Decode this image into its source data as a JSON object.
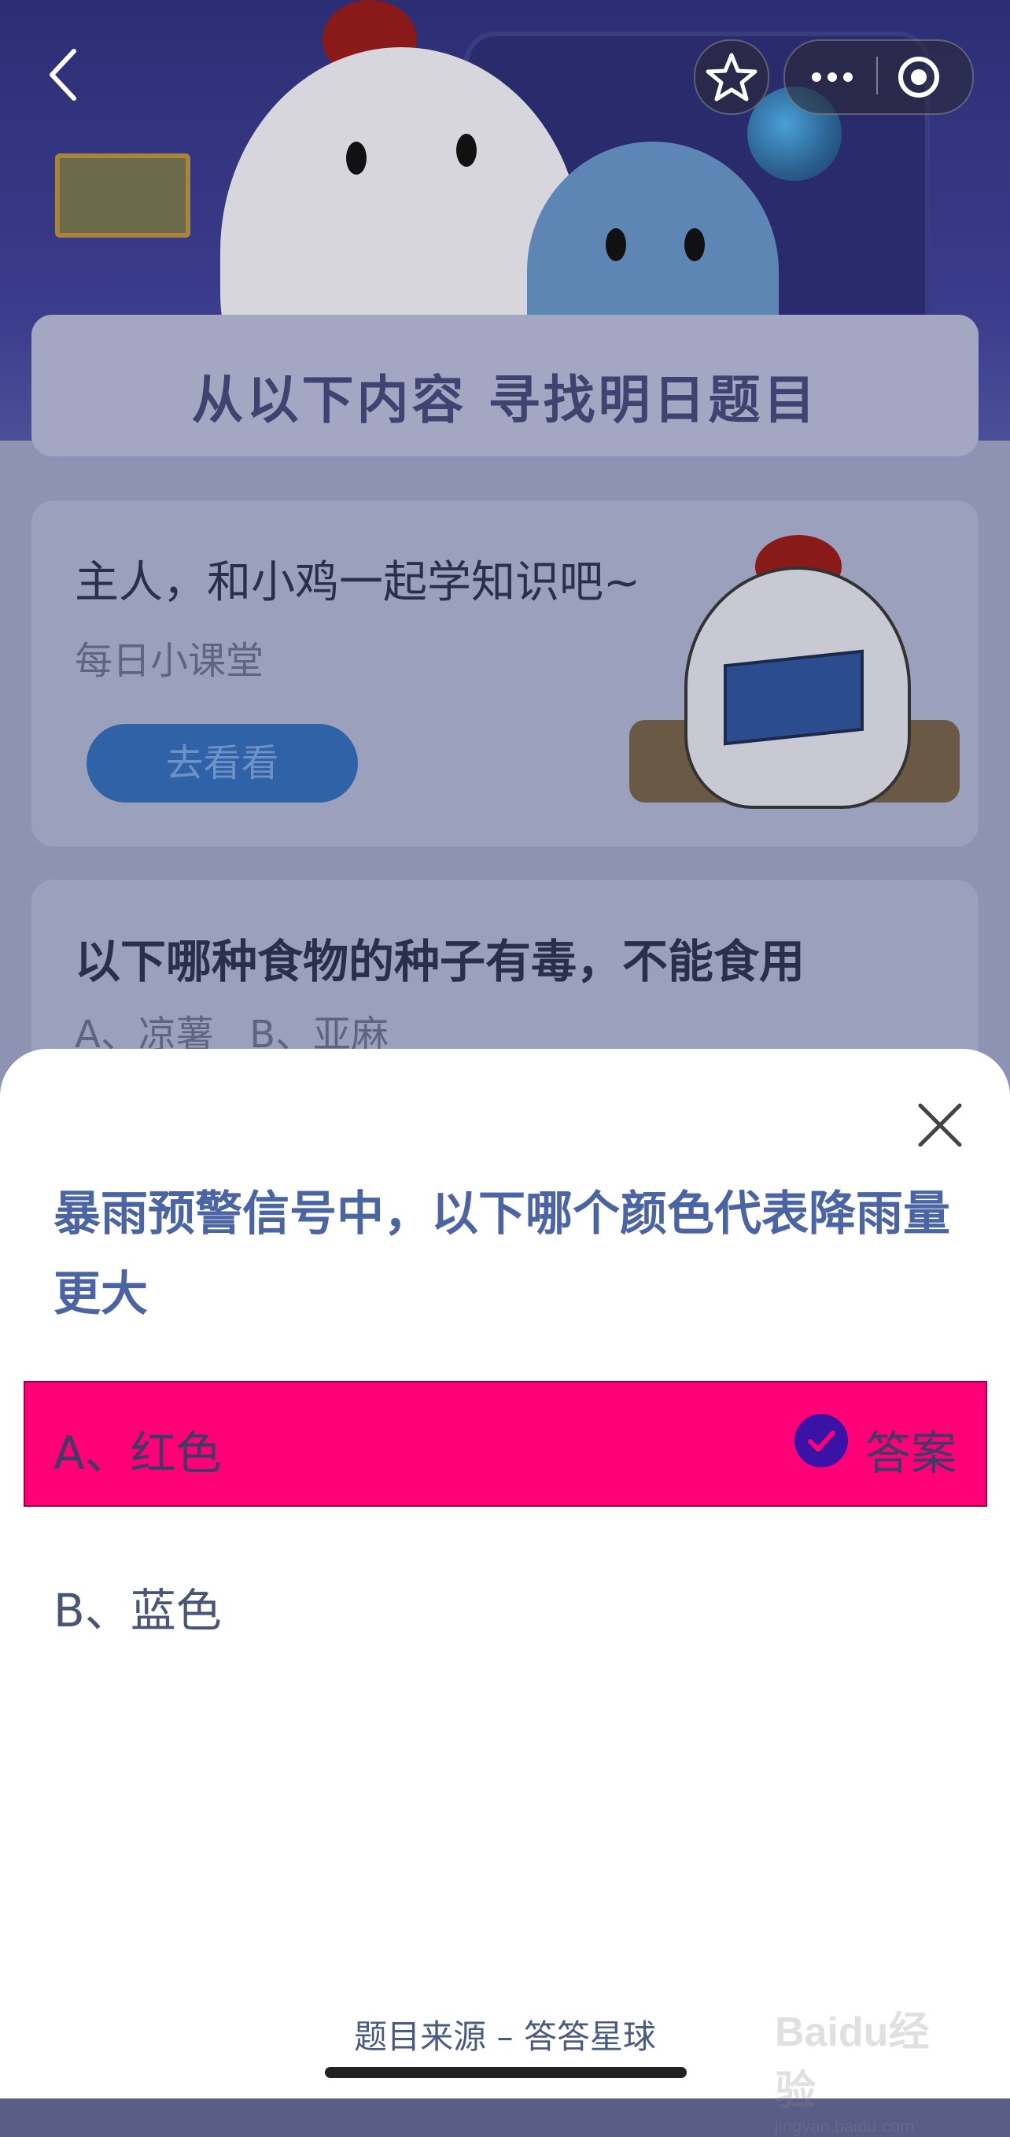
{
  "background": {
    "banner_title": "从以下内容  寻找明日题目",
    "lesson_card": {
      "title": "主人，和小鸡一起学知识吧~",
      "subtitle": "每日小课堂",
      "button": "去看看"
    },
    "quiz_card": {
      "question": "以下哪种食物的种子有毒，不能食用",
      "options": "A、凉薯    B、亚麻"
    }
  },
  "top_bar": {
    "back_icon": "chevron-left-icon",
    "favorite_icon": "star-icon",
    "more_icon": "ellipsis-icon",
    "close_miniapp_icon": "target-icon"
  },
  "sheet": {
    "question": "暴雨预警信号中，以下哪个颜色代表降雨量更大",
    "options": [
      {
        "label": "A、红色",
        "is_answer": true,
        "answer_tag": "答案"
      },
      {
        "label": "B、蓝色",
        "is_answer": false
      }
    ],
    "source": "题目来源 – 答答星球"
  },
  "watermark": {
    "text": "Baidu经验",
    "sub": "jingyan.baidu.com"
  },
  "colors": {
    "correct_bg": "#ff0077",
    "question_text": "#4a64a4",
    "check_badge": "#3a12a5"
  }
}
